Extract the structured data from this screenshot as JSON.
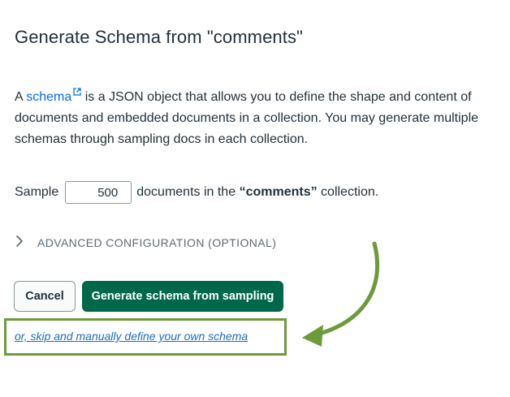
{
  "title": "Generate Schema from \"comments\"",
  "description": {
    "prefix": "A ",
    "link": "schema",
    "suffix": " is a JSON object that allows you to define the shape and content of documents and embedded documents in a collection. You may generate multiple schemas through sampling docs in each collection."
  },
  "sample": {
    "label": "Sample",
    "value": "500",
    "after": "documents in the",
    "collection": "“comments”",
    "end": "collection."
  },
  "advanced_label": "ADVANCED CONFIGURATION (OPTIONAL)",
  "buttons": {
    "cancel": "Cancel",
    "generate": "Generate schema from sampling"
  },
  "skip_link": "or, skip and manually define your own schema",
  "icons": {
    "external": "external-link-icon",
    "chevron": "chevron-right-icon",
    "arrow": "curved-arrow-annotation"
  },
  "colors": {
    "primary_button": "#00684a",
    "link": "#016bf8",
    "annotation": "#6d9a3a"
  }
}
